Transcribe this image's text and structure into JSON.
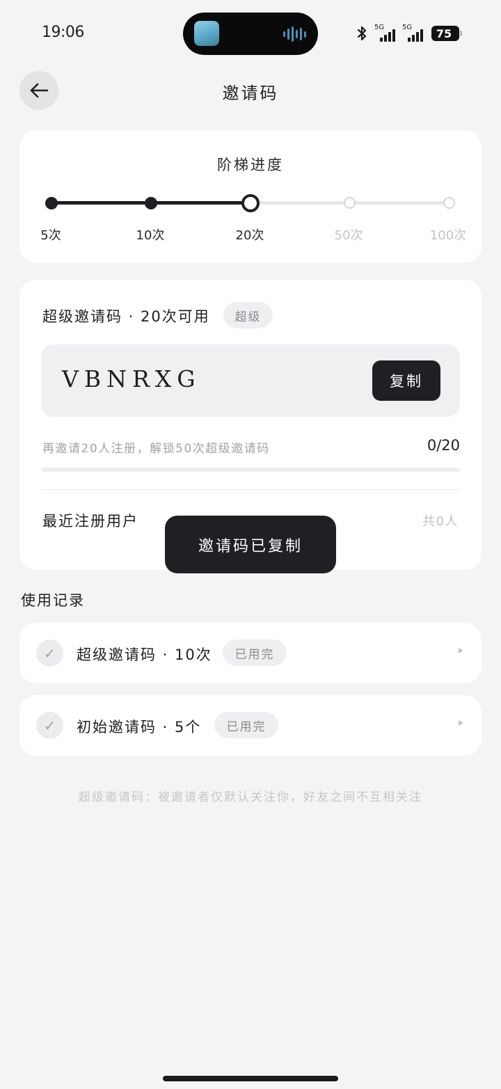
{
  "status_bar": {
    "time": "19:06",
    "network_1": "5G",
    "network_2": "5G",
    "battery": "75"
  },
  "header": {
    "title": "邀请码",
    "back_icon": "arrow-left-icon"
  },
  "ladder": {
    "title": "阶梯进度",
    "steps": [
      {
        "label": "5次",
        "state": "done"
      },
      {
        "label": "10次",
        "state": "done"
      },
      {
        "label": "20次",
        "state": "current"
      },
      {
        "label": "50次",
        "state": "future"
      },
      {
        "label": "100次",
        "state": "future"
      }
    ]
  },
  "code_card": {
    "title": "超级邀请码 · 20次可用",
    "badge": "超级",
    "code": "VBNRXG",
    "copy_label": "复制",
    "unlock_hint": "再邀请20人注册，解锁50次超级邀请码",
    "unlock_count": "0/20",
    "progress_fraction": 0,
    "recent_label": "最近注册用户",
    "recent_count": "共0人"
  },
  "toast": "邀请码已复制",
  "usage": {
    "title": "使用记录",
    "records": [
      {
        "label": "超级邀请码 · 10次",
        "status": "已用完",
        "icon": "check-icon"
      },
      {
        "label": "初始邀请码 · 5个",
        "status": "已用完",
        "icon": "check-icon"
      }
    ]
  },
  "footer_note": "超级邀请码：被邀请者仅默认关注你，好友之间不互相关注",
  "colors": {
    "background": "#f4f4f5",
    "card": "#ffffff",
    "accent_dark": "#1f1f24",
    "muted_text": "#a3a3a8"
  }
}
